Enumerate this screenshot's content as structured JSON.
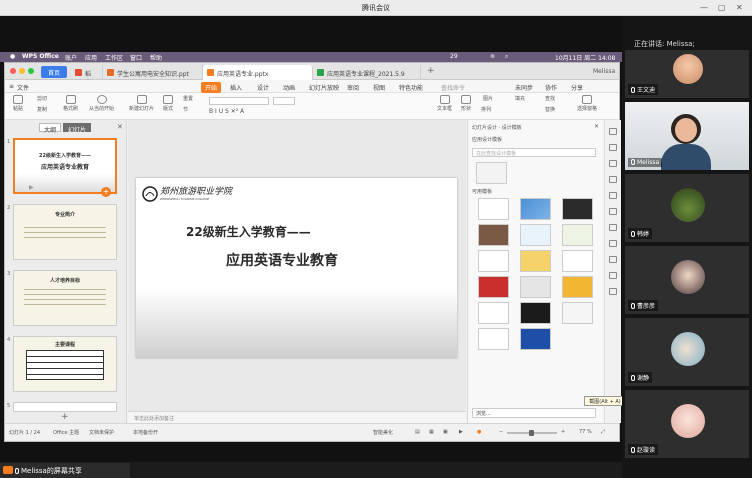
{
  "meeting": {
    "title": "腾讯会议",
    "share_label": "Melissa的屏幕共享",
    "speaking": "正在讲话: Melissa;",
    "participants": [
      {
        "name": "王文迪"
      },
      {
        "name": "Melissa"
      },
      {
        "name": "韩婷"
      },
      {
        "name": "曹彦彦"
      },
      {
        "name": "谢静"
      },
      {
        "name": "赵璇读"
      }
    ]
  },
  "mac": {
    "app": "WPS Office",
    "menus": [
      "账户",
      "应用",
      "工作区",
      "窗口",
      "帮助"
    ],
    "clock": "10月11日 周二 14:08",
    "battery": "29"
  },
  "wps": {
    "home_tab": "首页",
    "tabs": [
      {
        "label": "稻壳"
      },
      {
        "label": "学生公寓用电安全知识.ppt"
      },
      {
        "label": "应用英语专业.pptx"
      },
      {
        "label": "应用英语专业课程_2021.5.9"
      }
    ],
    "user": "Melissa",
    "menubar": [
      "文件",
      "开始",
      "插入",
      "设计",
      "动画",
      "幻灯片放映",
      "审阅",
      "视图",
      "特色功能"
    ],
    "search": "查找命令",
    "right_actions": [
      "未同步",
      "协作",
      "分享"
    ],
    "ribbon": [
      "粘贴",
      "剪切",
      "复制",
      "格式刷",
      "从当前开始",
      "新建幻灯片",
      "版式",
      "节",
      "重置",
      "文本框",
      "形状",
      "排列",
      "图片",
      "填充",
      "查找",
      "替换",
      "选择窗格"
    ],
    "left_tabs": [
      "大纲",
      "幻灯片"
    ],
    "slides": [
      {
        "num": "1",
        "title": "22级新生入学教育——",
        "subtitle": "应用英语专业教育"
      },
      {
        "num": "2",
        "title": "专业简介"
      },
      {
        "num": "3",
        "title": "人才培养目标"
      },
      {
        "num": "4",
        "title": "主要课程"
      },
      {
        "num": "5",
        "title": ""
      }
    ],
    "slide": {
      "logo_cn": "郑州旅游职业学院",
      "logo_en": "ZHENGZHOU TOURISM COLLEGE",
      "title": "22级新生入学教育——",
      "subtitle": "应用英语专业教育"
    },
    "notes_placeholder": "单击此处添加备注",
    "design_pane": {
      "header": "幻灯片设计 · 设计模板",
      "subheader": "应用设计模板",
      "search_placeholder": "在此查找设计模板",
      "section": "可用模板",
      "footer": "浏览..."
    },
    "status": {
      "slide_count": "幻灯片 1 / 24",
      "theme": "Office 主题",
      "doc_protect": "文档未保护",
      "backup": "本地备份开",
      "beautify": "智能美化",
      "zoom": "77 %"
    },
    "tooltip": "截图(Alt + A)"
  },
  "colors": {
    "accent": "#f47d20",
    "home_blue": "#3b7de9",
    "mac_bar": "#6a5b7a"
  }
}
